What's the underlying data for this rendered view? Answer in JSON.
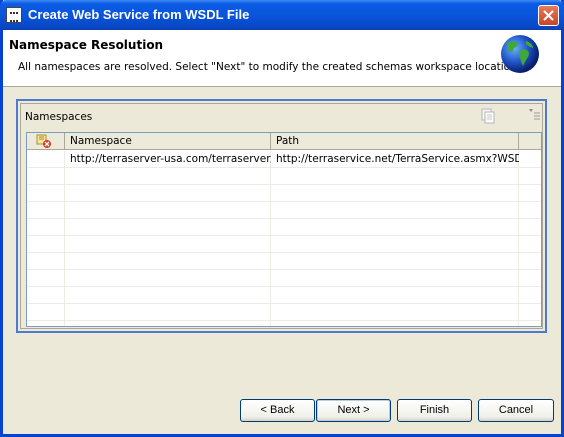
{
  "window": {
    "title": "Create Web Service from WSDL File"
  },
  "header": {
    "title": "Namespace Resolution",
    "description": "All namespaces are resolved. Select \"Next\" to modify the created schemas workspace locations."
  },
  "panel": {
    "label": "Namespaces"
  },
  "table": {
    "columns": [
      "",
      "Namespace",
      "Path"
    ],
    "rows": [
      {
        "namespace": "http://terraserver-usa.com/terraserver/",
        "path": "http://terraservice.net/TerraService.asmx?WSDL"
      }
    ]
  },
  "buttons": {
    "back": "< Back",
    "next": "Next >",
    "finish": "Finish",
    "cancel": "Cancel"
  },
  "icons": {
    "window": "wsdl-window-icon",
    "close": "close-icon",
    "globe": "globe-icon",
    "copy": "copy-icon",
    "menu": "view-menu-icon",
    "column_status": "namespace-status-icon"
  },
  "colors": {
    "titlebar": "#0a55db",
    "frame": "#0842d0",
    "panel_border": "#4c7ad0",
    "dialog_bg": "#ece9d8"
  }
}
